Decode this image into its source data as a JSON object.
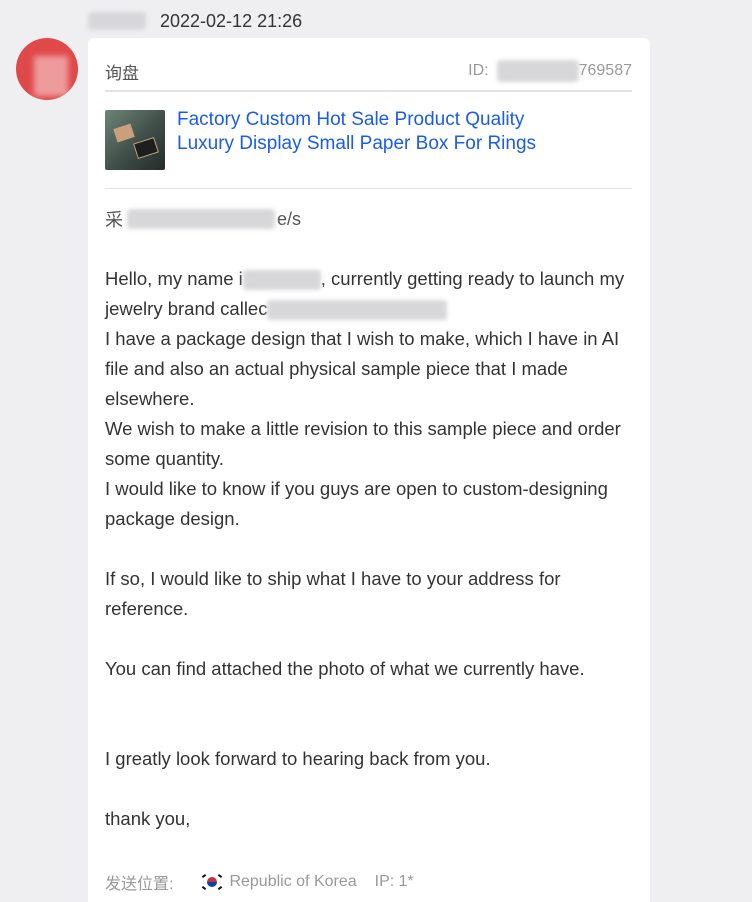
{
  "header": {
    "timestamp": "2022-02-12 21:26"
  },
  "card": {
    "inquiry_label": "询盘",
    "id_label": "ID:",
    "id_visible_suffix": "769587",
    "product_title": "Factory Custom Hot Sale Product Quality Luxury Display Small Paper Box For Rings",
    "quantity_prefix": "采",
    "quantity_suffix": "e/s",
    "message": {
      "p1_part1": "Hello, my name i",
      "p1_part2": ", currently getting ready to launch my jewelry brand callec",
      "p2": "I have a package design that I wish to make, which I have in AI file and also an actual physical sample piece that I made elsewhere.",
      "p3": "We wish to make a little revision to this sample piece and order some quantity.",
      "p4": "I would like to know if you guys are open to custom-designing package design.",
      "p5": "If so, I would like to ship what I have to your address for reference.",
      "p6": "You can find attached the photo of what we currently have.",
      "p7": "I greatly look forward to hearing back from you.",
      "p8": "thank you,"
    },
    "footer": {
      "location_label": "发送位置:",
      "country": "Republic of Korea",
      "ip_label": "IP: 1*",
      "flag_icon": "south-korea-flag-icon"
    }
  },
  "colors": {
    "background": "#efeff1",
    "link": "#1a5ce6",
    "avatar": "#e0494a"
  }
}
